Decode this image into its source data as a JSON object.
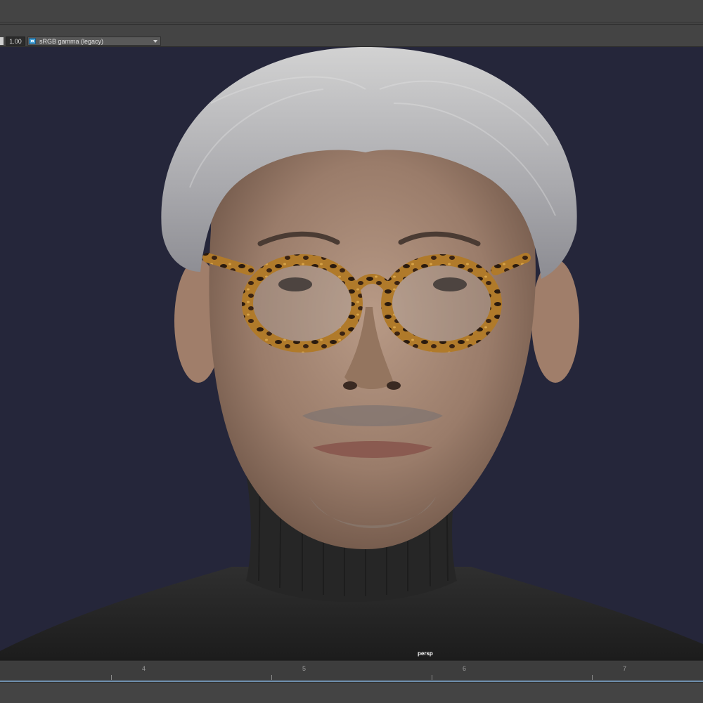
{
  "toolbar": {
    "exposure_value": "1.00",
    "view_transform": {
      "selected": "sRGB gamma (legacy)",
      "icon": "color-management-icon"
    }
  },
  "viewport": {
    "camera_label": "persp",
    "subject": "rendered-portrait"
  },
  "timeline": {
    "frames": [
      "4",
      "5",
      "6",
      "7"
    ]
  },
  "colors": {
    "viewport_background": "#25263a",
    "ui_panel": "#444444",
    "timeline_baseline": "#6f8fae",
    "accent": "#4aa3d8"
  }
}
